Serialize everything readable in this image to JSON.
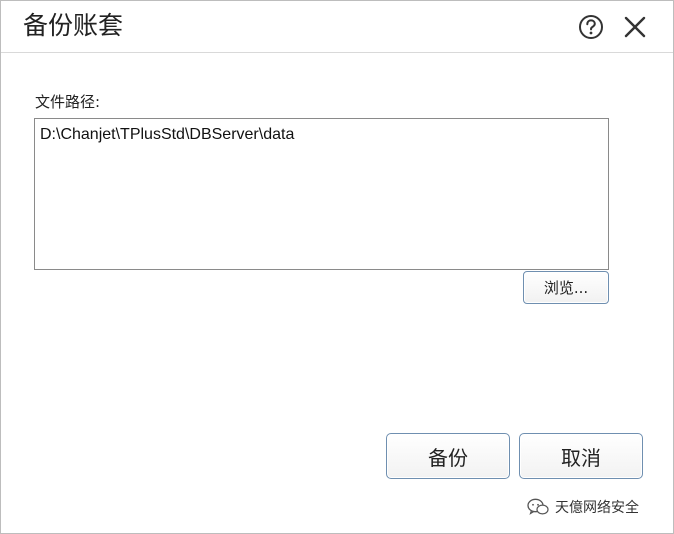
{
  "dialog": {
    "title": "备份账套",
    "help_icon": "help-circle-icon",
    "close_icon": "close-icon"
  },
  "form": {
    "path_label": "文件路径:",
    "path_value": "D:\\Chanjet\\TPlusStd\\DBServer\\data",
    "browse_label": "浏览..."
  },
  "actions": {
    "backup_label": "备份",
    "cancel_label": "取消"
  },
  "watermark": {
    "icon": "wechat-icon",
    "text": "天億网络安全"
  }
}
